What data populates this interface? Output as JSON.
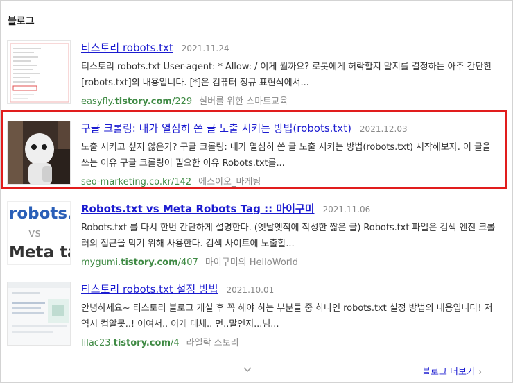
{
  "section": {
    "title": "블로그"
  },
  "results": [
    {
      "title": "티스토리 robots.txt",
      "date": "2021.11.24",
      "description": "티스토리 robots.txt User-agent: * Allow: / 이게 뭘까요? 로봇에게 허락할지 말지를 결정하는 아주 간단한 [robots.txt]의 내용입니다. [*]은 컴퓨터 정규 표현식에서...",
      "url_prefix": "easyfly.",
      "url_bold": "tistory.com",
      "url_suffix": "/229",
      "author": "실버를 위한 스마트교육",
      "thumb_icon": "document-thumbnail"
    },
    {
      "title": "구글 크롤링: 내가 열심히 쓴 글 노출 시키는 방법(robots.txt)",
      "date": "2021.12.03",
      "description": "노출 시키고 싶지 않은가? 구글 크롤링: 내가 열심히 쓴 글 노출 시키는 방법(robots.txt) 시작해보자. 이 글을 쓰는 이유 구글 크롤링이 필요한 이유 Robots.txt를...",
      "url_prefix": "seo-marketing.co.kr/142",
      "url_bold": "",
      "url_suffix": "",
      "author": "에스이오_마케팅",
      "thumb_icon": "robot-photo"
    },
    {
      "title": "Robots.txt vs Meta Robots Tag :: 마이구미",
      "date": "2021.11.06",
      "description": "Robots.txt 를 다시 한번 간단하게 설명한다. (옛날옛적에 작성한 짧은 글) Robots.txt 파일은 검색 엔진 크롤러의 접근을 막기 위해 사용한다. 검색 사이트에 노출할...",
      "url_prefix": "mygumi.",
      "url_bold": "tistory.com",
      "url_suffix": "/407",
      "author": "마이구미의 HelloWorld",
      "thumb_text_1": "robots.t",
      "thumb_text_2": "vs",
      "thumb_text_3": "Meta tag"
    },
    {
      "title": "티스토리 robots.txt 설정 방법",
      "date": "2021.10.01",
      "description": "안녕하세요~ 티스토리 블로그 개설 후 꼭 해야 하는 부분들 중 하나인 robots.txt 설정 방법의 내용입니다! 저 역시 컵알못..! 이여서.. 이게 대체.. 먼..말인지...넘...",
      "url_prefix": "lilac23.",
      "url_bold": "tistory.com",
      "url_suffix": "/4",
      "author": "라일락 스토리",
      "thumb_icon": "webpage-screenshot"
    }
  ],
  "footer": {
    "more_label": "블로그 더보기",
    "more_arrow": "›",
    "expand_icon": "chevron-down-icon"
  },
  "colors": {
    "link": "#1b1bd0",
    "url": "#3f8a44",
    "highlight": "#e11d1d"
  }
}
